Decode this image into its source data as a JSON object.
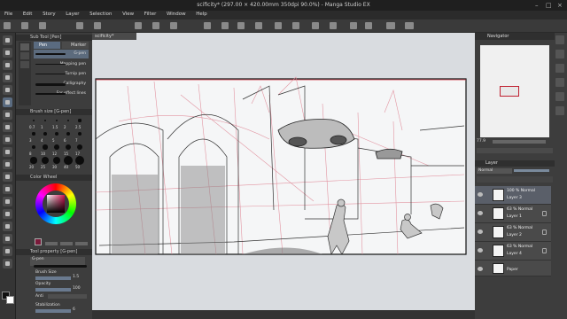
{
  "window": {
    "title": "scificity* (297.00 × 420.00mm 350dpi 90.0%) - Manga Studio EX"
  },
  "menu": [
    "File",
    "Edit",
    "Story",
    "Layer",
    "Selection",
    "View",
    "Filter",
    "Window",
    "Help"
  ],
  "document_tab": "scificity*",
  "subtool": {
    "header": "Sub Tool [Pen]",
    "tabs": [
      "Pen",
      "Marker"
    ],
    "brushes": [
      "G-pen",
      "Mapping pen",
      "Turnip pen",
      "Calligraphy",
      "For effect lines"
    ]
  },
  "brush_size": {
    "header": "Brush size [G-pen]",
    "sizes": [
      "0.7",
      "1",
      "1.5",
      "2",
      "2.5",
      "3",
      "4",
      "5",
      "6",
      "7",
      "8",
      "10",
      "12",
      "15",
      "17",
      "20",
      "25",
      "30",
      "40",
      "50"
    ]
  },
  "color_wheel": {
    "header": "Color Wheel"
  },
  "tool_property": {
    "header": "Tool property [G-pen]",
    "preset": "G-pen",
    "brush_size_label": "Brush Size",
    "brush_size_value": "1.5",
    "opacity_label": "Opacity",
    "opacity_value": "100",
    "aa_label": "Anti",
    "stabilization_label": "Stabilization",
    "stabilization_value": "6"
  },
  "navigator": {
    "header": "Navigator",
    "zoom": "77.9"
  },
  "layer_panel": {
    "header": "Layer",
    "blend_mode": "Normal",
    "opacity": "100",
    "layers": [
      {
        "opacity_mode": "100 %  Normal",
        "name": "Layer 3",
        "selected": true,
        "locked": false
      },
      {
        "opacity_mode": "63 %  Normal",
        "name": "Layer 1",
        "selected": false,
        "locked": true
      },
      {
        "opacity_mode": "63 %  Normal",
        "name": "Layer 2",
        "selected": false,
        "locked": true
      },
      {
        "opacity_mode": "63 %  Normal",
        "name": "Layer 4",
        "selected": false,
        "locked": true
      },
      {
        "opacity_mode": "",
        "name": "Paper",
        "selected": false,
        "locked": false
      }
    ]
  },
  "colors": {
    "main_color": "#111111",
    "sub_color": "#ffffff",
    "picked_color": "#7a1a3a"
  }
}
